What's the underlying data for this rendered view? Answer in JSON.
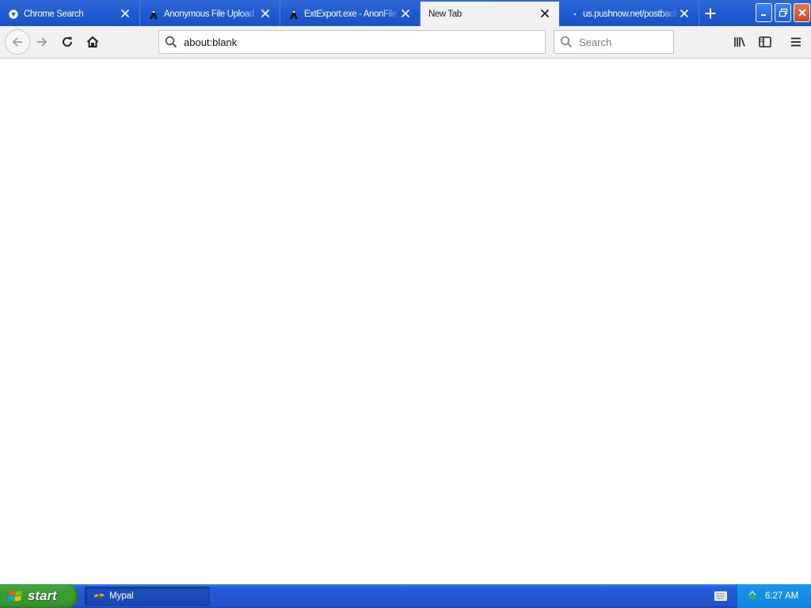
{
  "browser": {
    "tabs": [
      {
        "label": "Chrome Search",
        "icon": "chrome-search-icon",
        "active": false
      },
      {
        "label": "Anonymous File Upload",
        "icon": "anonfile-icon",
        "active": false
      },
      {
        "label": "ExtExport.exe - AnonFile",
        "icon": "anonfile-icon",
        "active": false
      },
      {
        "label": "New Tab",
        "icon": "",
        "active": true
      },
      {
        "label": "us.pushnow.net/postback",
        "icon": "loading-dot-icon",
        "active": false
      }
    ],
    "url": "about:blank",
    "search_placeholder": "Search"
  },
  "taskbar": {
    "start_label": "start",
    "tasks": [
      {
        "label": "Mypal",
        "icon": "mypal-icon"
      }
    ],
    "clock": "6:27 AM"
  },
  "colors": {
    "titlebar_blue": "#1c58d0",
    "taskbar_blue": "#2457d3",
    "start_green": "#3c9e37",
    "tray_blue": "#0f84de"
  }
}
